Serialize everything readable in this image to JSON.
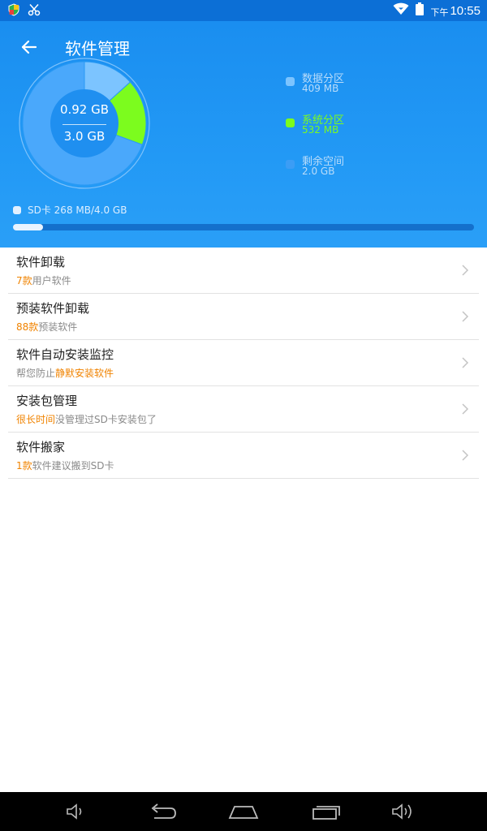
{
  "status_bar": {
    "clock_prefix": "下午",
    "time": "10:55",
    "icons": [
      "shield-app-icon",
      "scissors-icon",
      "wifi-icon",
      "battery-icon"
    ]
  },
  "header": {
    "title": "软件管理",
    "used": "0.92 GB",
    "total": "3.0 GB"
  },
  "storage_chart": {
    "type": "pie",
    "segments": [
      {
        "name": "数据分区",
        "value_text": "409 MB",
        "value_mb": 409,
        "color": "#7cc4ff"
      },
      {
        "name": "系统分区",
        "value_text": "532 MB",
        "value_mb": 532,
        "color": "#7cfc1e"
      },
      {
        "name": "剩余空间",
        "value_text": "2.0 GB",
        "value_mb": 2131,
        "color": "#4aa8fb"
      }
    ]
  },
  "legend_colors": {
    "data_text": "#b9dcfa",
    "system_text": "#7cfc1e",
    "free_text": "#b9dcfa"
  },
  "sd": {
    "label": "SD卡 268 MB/4.0 GB",
    "used_fraction": 0.065
  },
  "list_items": [
    {
      "title": "软件卸载",
      "highlight": "7款",
      "rest": "用户软件",
      "order": "hl-first"
    },
    {
      "title": "预装软件卸载",
      "highlight": "88款",
      "rest": "预装软件",
      "order": "hl-first"
    },
    {
      "title": "软件自动安装监控",
      "highlight": "静默安装软件",
      "rest": "帮您防止",
      "order": "hl-last"
    },
    {
      "title": "安装包管理",
      "highlight": "很长时间",
      "rest": "没管理过SD卡安装包了",
      "order": "hl-first"
    },
    {
      "title": "软件搬家",
      "highlight": "1款",
      "rest": "软件建议搬到SD卡",
      "order": "hl-first"
    }
  ],
  "nav_bar": {
    "buttons": [
      "volume-down-icon",
      "back-icon",
      "home-icon",
      "recents-icon",
      "volume-up-icon"
    ]
  },
  "colors": {
    "header_blue": "#2299f5",
    "highlight_orange": "#f08300"
  }
}
